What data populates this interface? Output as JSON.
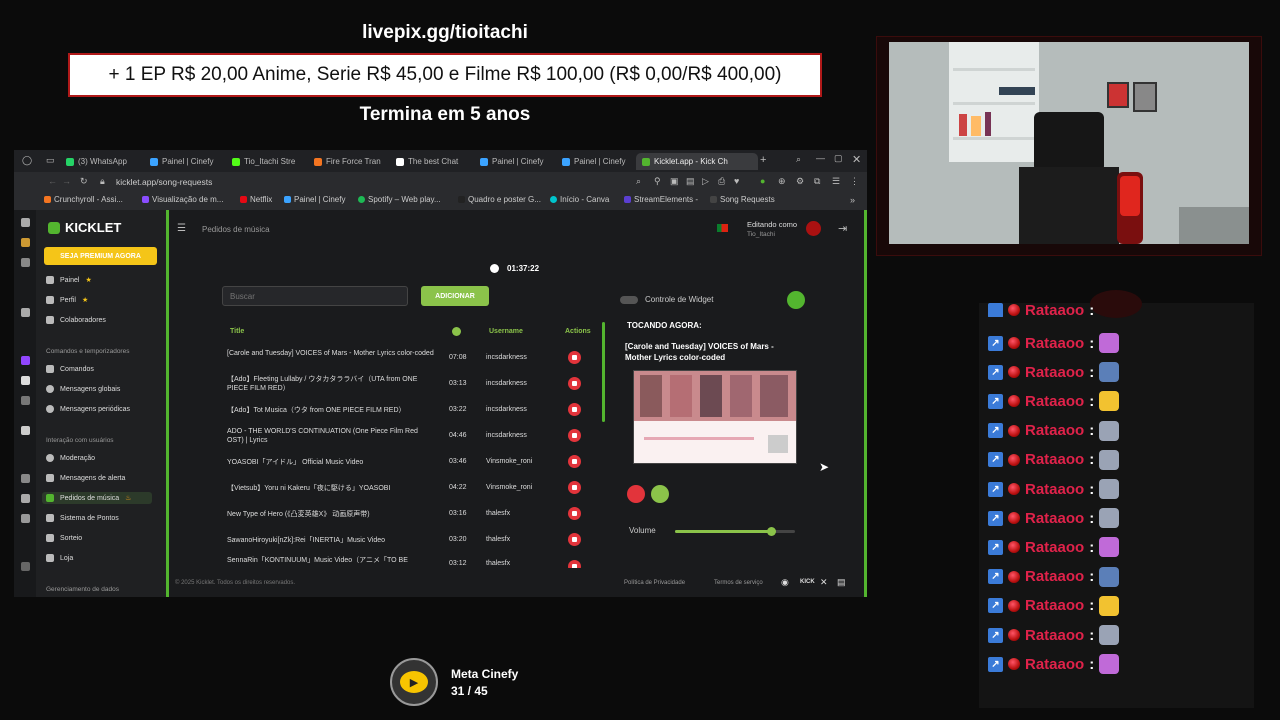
{
  "overlay": {
    "link": "livepix.gg/tioitachi",
    "goal": "+ 1 EP R$ 20,00 Anime, Serie R$ 45,00 e Filme R$ 100,00 (R$ 0,00/R$ 400,00)",
    "ends": "Termina em 5 anos"
  },
  "browser": {
    "tabs": [
      {
        "label": "(3) WhatsApp",
        "icon": "whatsapp-icon",
        "color": "#25d366"
      },
      {
        "label": "Painel | Cinefy",
        "icon": "cinefy-icon",
        "color": "#3ba3ff"
      },
      {
        "label": "Tio_Itachi Stre",
        "icon": "kick-icon",
        "color": "#53fc18"
      },
      {
        "label": "Fire Force Tran",
        "icon": "crunchyroll-icon",
        "color": "#f47521"
      },
      {
        "label": "The best Chat",
        "icon": "chat-icon",
        "color": "#ffffff"
      },
      {
        "label": "Painel | Cinefy",
        "icon": "cinefy-icon",
        "color": "#3ba3ff"
      },
      {
        "label": "Painel | Cinefy",
        "icon": "cinefy-icon",
        "color": "#3ba3ff"
      },
      {
        "label": "Kicklet.app - Kick Ch",
        "icon": "kicklet-icon",
        "color": "#53b52f"
      }
    ],
    "url": "kicklet.app/song-requests",
    "bookmarks": [
      {
        "label": "Crunchyroll - Assi...",
        "color": "#f47521"
      },
      {
        "label": "Visualização de m...",
        "color": "#8a4dff"
      },
      {
        "label": "Netflix",
        "color": "#e50914"
      },
      {
        "label": "Painel | Cinefy",
        "color": "#3ba3ff"
      },
      {
        "label": "Spotify – Web play...",
        "color": "#1db954"
      },
      {
        "label": "Quadro e poster G...",
        "color": "#222222"
      },
      {
        "label": "Início - Canva",
        "color": "#00c4cc"
      },
      {
        "label": "StreamElements -",
        "color": "#5b3fd1"
      },
      {
        "label": "Song Requests",
        "color": "#444444"
      }
    ]
  },
  "app": {
    "brand": "KICKLET",
    "premium": "SEJA PREMIUM AGORA",
    "breadcrumb": "Pedidos de música",
    "editing_as": "Editando como",
    "user": "Tio_Itachi",
    "sidebar": {
      "main": [
        {
          "label": "Painel",
          "icon": "dashboard-icon",
          "star": true
        },
        {
          "label": "Perfil",
          "icon": "profile-icon",
          "star": true
        },
        {
          "label": "Colaboradores",
          "icon": "collaborators-icon"
        }
      ],
      "section1": "Comandos e temporizadores",
      "cmds": [
        {
          "label": "Comandos",
          "icon": "commands-icon"
        },
        {
          "label": "Mensagens globais",
          "icon": "global-messages-icon"
        },
        {
          "label": "Mensagens periódicas",
          "icon": "periodic-messages-icon"
        }
      ],
      "section2": "Interação com usuários",
      "interact": [
        {
          "label": "Moderação",
          "icon": "moderation-icon"
        },
        {
          "label": "Mensagens de alerta",
          "icon": "alert-icon"
        },
        {
          "label": "Pedidos de música",
          "icon": "music-icon",
          "active": true
        },
        {
          "label": "Sistema de Pontos",
          "icon": "points-icon"
        },
        {
          "label": "Sorteio",
          "icon": "raffle-icon"
        },
        {
          "label": "Loja",
          "icon": "shop-icon"
        }
      ],
      "section3": "Gerenciamento de dados"
    },
    "timer": "01:37:22",
    "search_placeholder": "Buscar",
    "add_button": "ADICIONAR",
    "widget_control": "Controle de Widget",
    "columns": {
      "title": "Title",
      "username": "Username",
      "actions": "Actions"
    },
    "songs": [
      {
        "title": "[Carole and Tuesday] VOICES of Mars - Mother Lyrics color-coded",
        "duration": "07:08",
        "user": "incsdarkness"
      },
      {
        "title": "【Ado】Fleeting Lullaby / ウタカタララバイ（UTA from ONE PIECE FILM RED）",
        "duration": "03:13",
        "user": "incsdarkness"
      },
      {
        "title": "【Ado】Tot Musica（ウタ from ONE PIECE FILM RED）",
        "duration": "03:22",
        "user": "incsdarkness"
      },
      {
        "title": "ADO - THE WORLD'S CONTINUATION (One Piece Film Red OST) | Lyrics",
        "duration": "04:46",
        "user": "incsdarkness"
      },
      {
        "title": "YOASOBI「アイドル」 Official Music Video",
        "duration": "03:46",
        "user": "Vinsmoke_roni"
      },
      {
        "title": "【Vietsub】Yoru ni Kakeru「夜に駆ける」YOASOBI",
        "duration": "04:22",
        "user": "Vinsmoke_roni"
      },
      {
        "title": "New Type of Hero (《凸変英雄X》 动画原声带)",
        "duration": "03:16",
        "user": "thalesfx"
      },
      {
        "title": "SawanoHiroyuki[nZk]:Rei「INERTIA」Music Video",
        "duration": "03:20",
        "user": "thalesfx"
      },
      {
        "title": "SennaRin「KONTINUUM」Music Video（アニメ「TO BE",
        "duration": "03:12",
        "user": "thalesfx"
      }
    ],
    "now_playing_label": "TOCANDO AGORA:",
    "now_playing_title": "[Carole and Tuesday] VOICES of Mars - Mother Lyrics color-coded",
    "volume_label": "Volume",
    "volume": 0.8,
    "footer": "© 2025 Kicklet. Todos os direitos reservados.",
    "privacy": "Política de Privacidade",
    "terms": "Termos de serviço",
    "accent": "#53b52f"
  },
  "chat": {
    "name": "Rataaoo",
    "colon": ":",
    "emotes": [
      "pink-cat-emote",
      "computer-emote",
      "yellow-cat-emote",
      "seal-emote",
      "seal-emote",
      "seal-emote",
      "seal-emote",
      "pink-cat-emote",
      "computer-emote",
      "yellow-cat-emote",
      "seal-emote",
      "pink-cat-emote"
    ],
    "top_partial": "Rataaoo"
  },
  "meta": {
    "label": "Meta Cinefy",
    "progress": "31 / 45"
  }
}
